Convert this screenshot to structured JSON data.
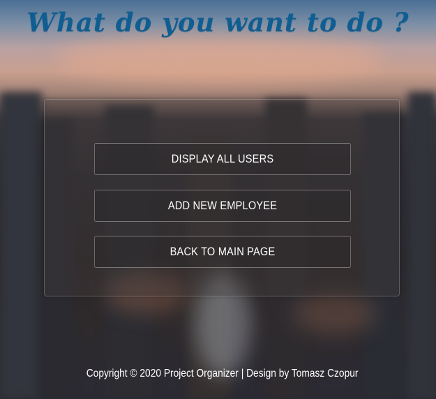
{
  "header": {
    "title": "What do you want to do ?"
  },
  "menu": {
    "items": [
      {
        "label": "DISPLAY ALL USERS"
      },
      {
        "label": "ADD NEW EMPLOYEE"
      },
      {
        "label": "BACK TO MAIN PAGE"
      }
    ]
  },
  "footer": {
    "text": "Copyright © 2020 Project Organizer | Design by Tomasz Czopur"
  },
  "colors": {
    "title": "#0f5e92",
    "button_text": "#ffffff",
    "footer_text": "#ffffff"
  }
}
